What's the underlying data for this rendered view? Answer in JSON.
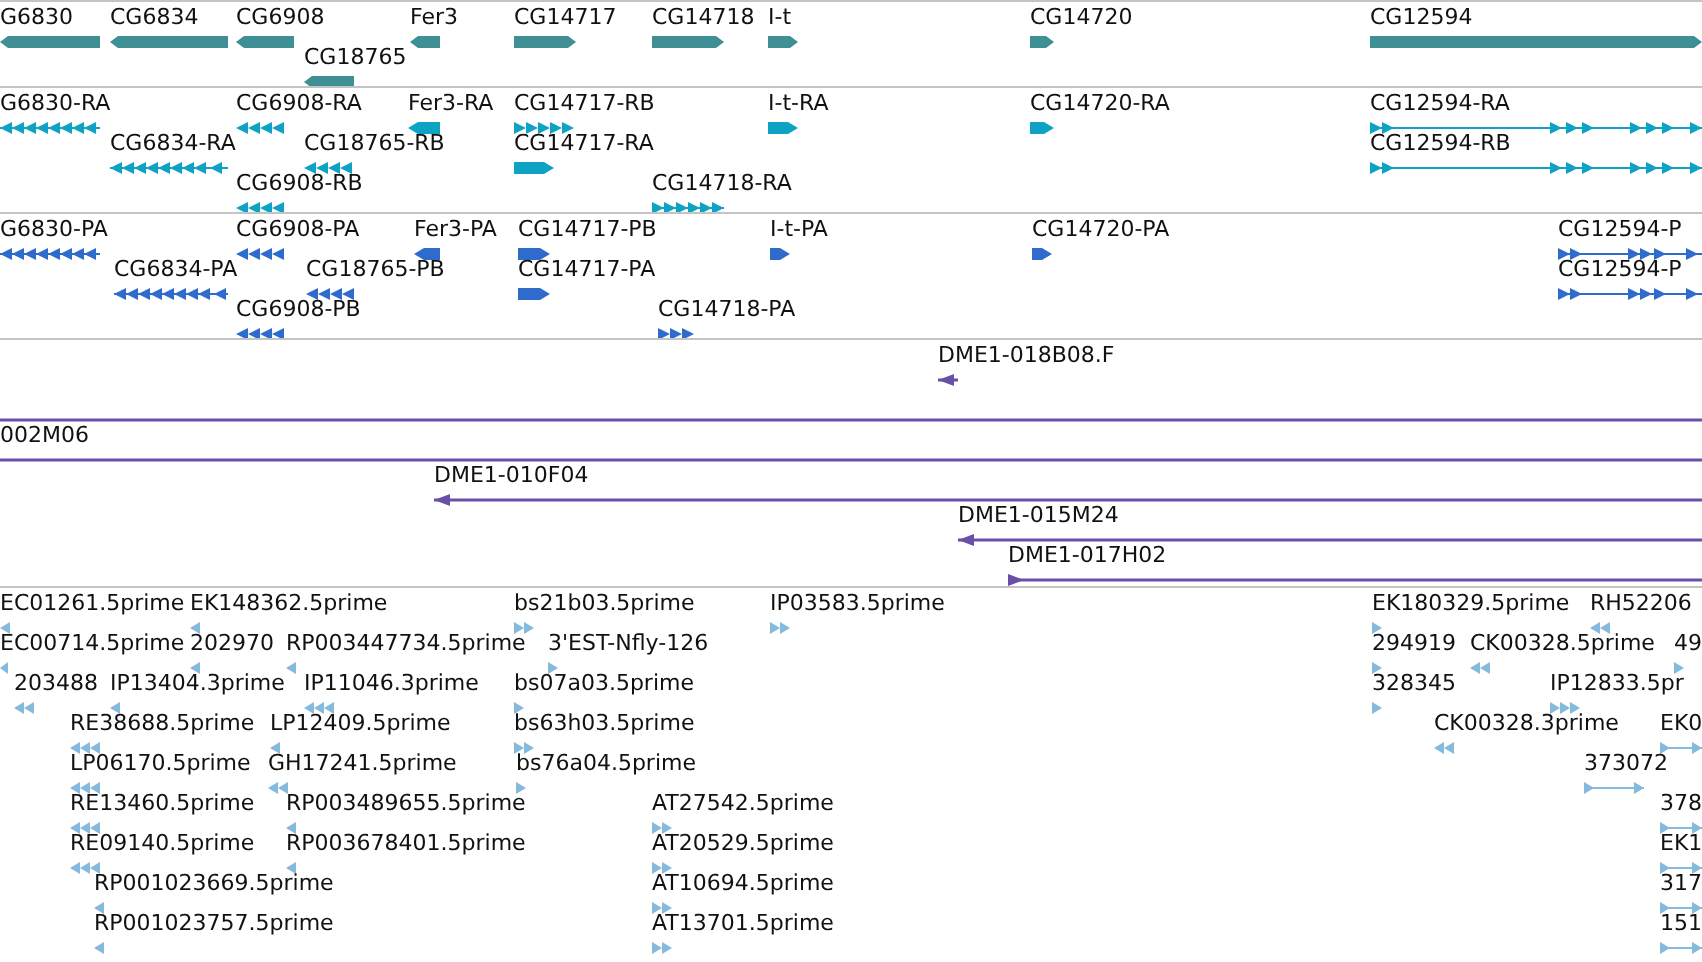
{
  "tracks": [
    {
      "kind": "gene",
      "color": "#3f9094",
      "features": [
        {
          "label": "G6830",
          "reverse": true
        },
        {
          "label": "CG6834",
          "reverse": true
        },
        {
          "label": "CG6908",
          "reverse": true
        },
        {
          "label": "CG18765",
          "reverse": true
        },
        {
          "label": "Fer3",
          "reverse": true
        },
        {
          "label": "CG14717",
          "reverse": false
        },
        {
          "label": "CG14718",
          "reverse": false
        },
        {
          "label": "I-t",
          "reverse": false
        },
        {
          "label": "CG14720",
          "reverse": false
        },
        {
          "label": "CG12594",
          "reverse": false
        }
      ]
    },
    {
      "kind": "transcript",
      "color": "#0ea3c4",
      "features": [
        {
          "label": "G6830-RA",
          "reverse": true
        },
        {
          "label": "CG6908-RA",
          "reverse": true
        },
        {
          "label": "Fer3-RA",
          "reverse": true
        },
        {
          "label": "CG14717-RB",
          "reverse": false
        },
        {
          "label": "I-t-RA",
          "reverse": false
        },
        {
          "label": "CG14720-RA",
          "reverse": false
        },
        {
          "label": "CG12594-RA",
          "reverse": false
        },
        {
          "label": "CG6834-RA",
          "reverse": true
        },
        {
          "label": "CG18765-RB",
          "reverse": true
        },
        {
          "label": "CG14717-RA",
          "reverse": false
        },
        {
          "label": "CG12594-RB",
          "reverse": false
        },
        {
          "label": "CG6908-RB",
          "reverse": true
        },
        {
          "label": "CG14718-RA",
          "reverse": false
        }
      ]
    },
    {
      "kind": "protein",
      "color": "#2f6bcc",
      "features": [
        {
          "label": "G6830-PA",
          "reverse": true
        },
        {
          "label": "CG6908-PA",
          "reverse": true
        },
        {
          "label": "Fer3-PA",
          "reverse": true
        },
        {
          "label": "CG14717-PB",
          "reverse": false
        },
        {
          "label": "I-t-PA",
          "reverse": false
        },
        {
          "label": "CG14720-PA",
          "reverse": false
        },
        {
          "label": "CG12594-P",
          "reverse": false
        },
        {
          "label": "CG6834-PA",
          "reverse": true
        },
        {
          "label": "CG18765-PB",
          "reverse": true
        },
        {
          "label": "CG14717-PA",
          "reverse": false
        },
        {
          "label": "CG12594-P",
          "reverse": false
        },
        {
          "label": "CG6908-PB",
          "reverse": true
        },
        {
          "label": "CG14718-PA",
          "reverse": false
        }
      ]
    },
    {
      "kind": "clone",
      "color": "#6a4fa8",
      "features": [
        {
          "label": "DME1-018B08.F",
          "reverse": true
        },
        {
          "label": "002M06"
        },
        {
          "label": "DME1-010F04",
          "reverse": true
        },
        {
          "label": "DME1-015M24",
          "reverse": true
        },
        {
          "label": "DME1-017H02",
          "reverse": false
        }
      ]
    },
    {
      "kind": "est",
      "color": "#84bade",
      "features": [
        {
          "label": "EC01261.5prime",
          "reverse": true
        },
        {
          "label": "EK148362.5prime",
          "reverse": true
        },
        {
          "label": "bs21b03.5prime",
          "reverse": false
        },
        {
          "label": "IP03583.5prime",
          "reverse": false
        },
        {
          "label": "EK180329.5prime",
          "reverse": false
        },
        {
          "label": "RH52206",
          "reverse": true
        },
        {
          "label": "EC00714.5prime",
          "reverse": true
        },
        {
          "label": "202970",
          "reverse": true
        },
        {
          "label": "RP003447734.5prime",
          "reverse": true
        },
        {
          "label": "3'EST-Nfly-126",
          "reverse": false
        },
        {
          "label": "294919",
          "reverse": false
        },
        {
          "label": "CK00328.5prime",
          "reverse": true
        },
        {
          "label": "49",
          "reverse": false
        },
        {
          "label": "203488",
          "reverse": true
        },
        {
          "label": "IP13404.3prime",
          "reverse": true
        },
        {
          "label": "IP11046.3prime",
          "reverse": true
        },
        {
          "label": "bs07a03.5prime",
          "reverse": false
        },
        {
          "label": "328345",
          "reverse": false
        },
        {
          "label": "IP12833.5pr",
          "reverse": false
        },
        {
          "label": "RE38688.5prime",
          "reverse": true
        },
        {
          "label": "LP12409.5prime",
          "reverse": true
        },
        {
          "label": "bs63h03.5prime",
          "reverse": false
        },
        {
          "label": "CK00328.3prime",
          "reverse": true
        },
        {
          "label": "EK0",
          "reverse": false
        },
        {
          "label": "LP06170.5prime",
          "reverse": true
        },
        {
          "label": "GH17241.5prime",
          "reverse": true
        },
        {
          "label": "bs76a04.5prime",
          "reverse": false
        },
        {
          "label": "373072",
          "reverse": false
        },
        {
          "label": "RE13460.5prime",
          "reverse": true
        },
        {
          "label": "RP003489655.5prime",
          "reverse": true
        },
        {
          "label": "AT27542.5prime",
          "reverse": false
        },
        {
          "label": "378",
          "reverse": false
        },
        {
          "label": "RE09140.5prime",
          "reverse": true
        },
        {
          "label": "RP003678401.5prime",
          "reverse": true
        },
        {
          "label": "AT20529.5prime",
          "reverse": false
        },
        {
          "label": "EK1",
          "reverse": false
        },
        {
          "label": "RP001023669.5prime",
          "reverse": true
        },
        {
          "label": "AT10694.5prime",
          "reverse": false
        },
        {
          "label": "317",
          "reverse": false
        },
        {
          "label": "RP001023757.5prime",
          "reverse": true
        },
        {
          "label": "AT13701.5prime",
          "reverse": false
        },
        {
          "label": "151",
          "reverse": false
        }
      ]
    }
  ]
}
